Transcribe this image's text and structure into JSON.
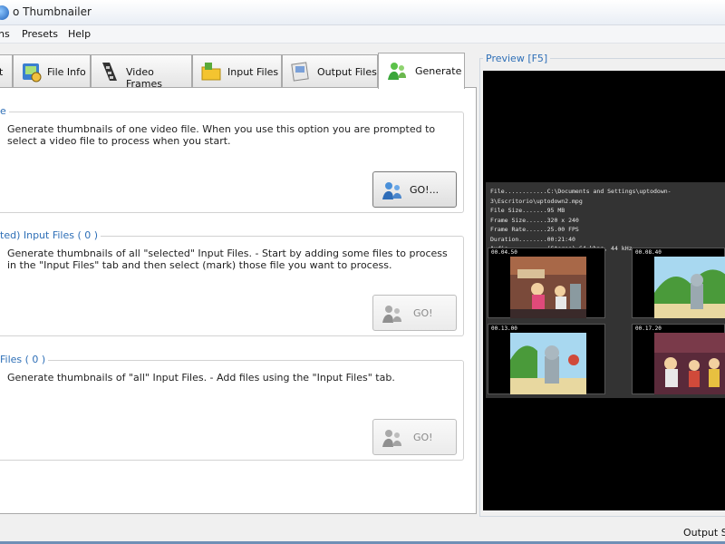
{
  "window": {
    "title": "o Thumbnailer"
  },
  "menu": {
    "items": [
      "ns",
      "Presets",
      "Help"
    ]
  },
  "tabs": [
    {
      "label": "t"
    },
    {
      "label": "File Info"
    },
    {
      "label": "Video Frames"
    },
    {
      "label": "Input Files"
    },
    {
      "label": "Output Files"
    },
    {
      "label": "Generate"
    }
  ],
  "groups": {
    "single": {
      "title": "e",
      "description": "Generate thumbnails of one video file. When you use this option you are prompted to select a video file to process when you start.",
      "button": "GO!..."
    },
    "selected": {
      "title": "ted) Input Files ( 0 )",
      "description": "Generate thumbnails of all \"selected\" Input Files. - Start by adding some files to process in the \"Input Files\" tab and then select (mark) those file you want to process.",
      "button": "GO!"
    },
    "all": {
      "title": "Files ( 0 )",
      "description": "Generate thumbnails of \"all\" Input Files. - Add files using the \"Input Files\" tab.",
      "button": "GO!"
    }
  },
  "preview": {
    "label": "Preview  [F5]",
    "info": [
      "File............C:\\Documents  and  Settings\\uptodown-3\\Escritorio\\uptodown2.mpg",
      "File Size.......95 MB",
      "Frame Size......320 x 240",
      "Frame Rate......25.00 FPS",
      "Duration........00:21:40",
      "Audio...........(Stereo) 64 kbps, 44 kHz"
    ],
    "thumbs": [
      {
        "time": "00.04.50"
      },
      {
        "time": "00.08.40"
      },
      {
        "time": "00.13.00"
      },
      {
        "time": "00.17.20"
      }
    ]
  },
  "status": {
    "text": "Output Siz"
  },
  "colors": {
    "accent": "#2e6fb7",
    "preview_bg": "#000000"
  }
}
